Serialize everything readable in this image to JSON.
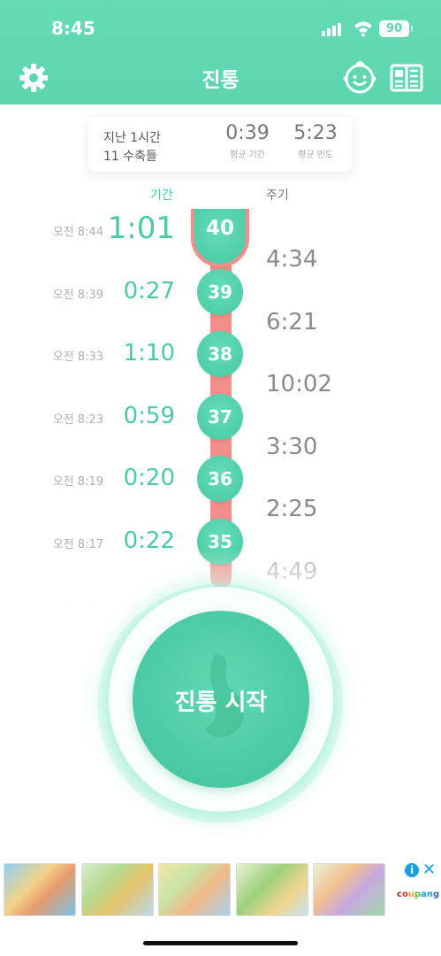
{
  "status_bar": {
    "time": "8:45",
    "battery": "90"
  },
  "header": {
    "title": "진통",
    "icons": [
      "gear-icon",
      "baby-face-icon",
      "book-icon"
    ]
  },
  "summary": {
    "line1": "지난 1시간",
    "line2": "11 수축들",
    "avg_duration": {
      "value": "0:39",
      "label": "평균 기간"
    },
    "avg_frequency": {
      "value": "5:23",
      "label": "평균 빈도"
    }
  },
  "columns": {
    "duration": "기간",
    "interval": "주기"
  },
  "contractions": [
    {
      "num": "40",
      "time": "오전 8:44",
      "duration": "1:01"
    },
    {
      "num": "39",
      "time": "오전 8:39",
      "duration": "0:27"
    },
    {
      "num": "38",
      "time": "오전 8:33",
      "duration": "1:10"
    },
    {
      "num": "37",
      "time": "오전 8:23",
      "duration": "0:59"
    },
    {
      "num": "36",
      "time": "오전 8:19",
      "duration": "0:20"
    },
    {
      "num": "35",
      "time": "오전 8:17",
      "duration": "0:22"
    },
    {
      "time": "오전 8:12",
      "duration": "1:"
    }
  ],
  "intervals": [
    "4:34",
    "6:21",
    "10:02",
    "3:30",
    "2:25",
    "4:49"
  ],
  "start_button": {
    "label": "진통 시작"
  },
  "ad": {
    "brand": "coupang",
    "info": "i",
    "close": "✕"
  },
  "colors": {
    "accent": "#5dd5b0",
    "track": "#f28f8a",
    "duration_text": "#4ccaa4"
  }
}
